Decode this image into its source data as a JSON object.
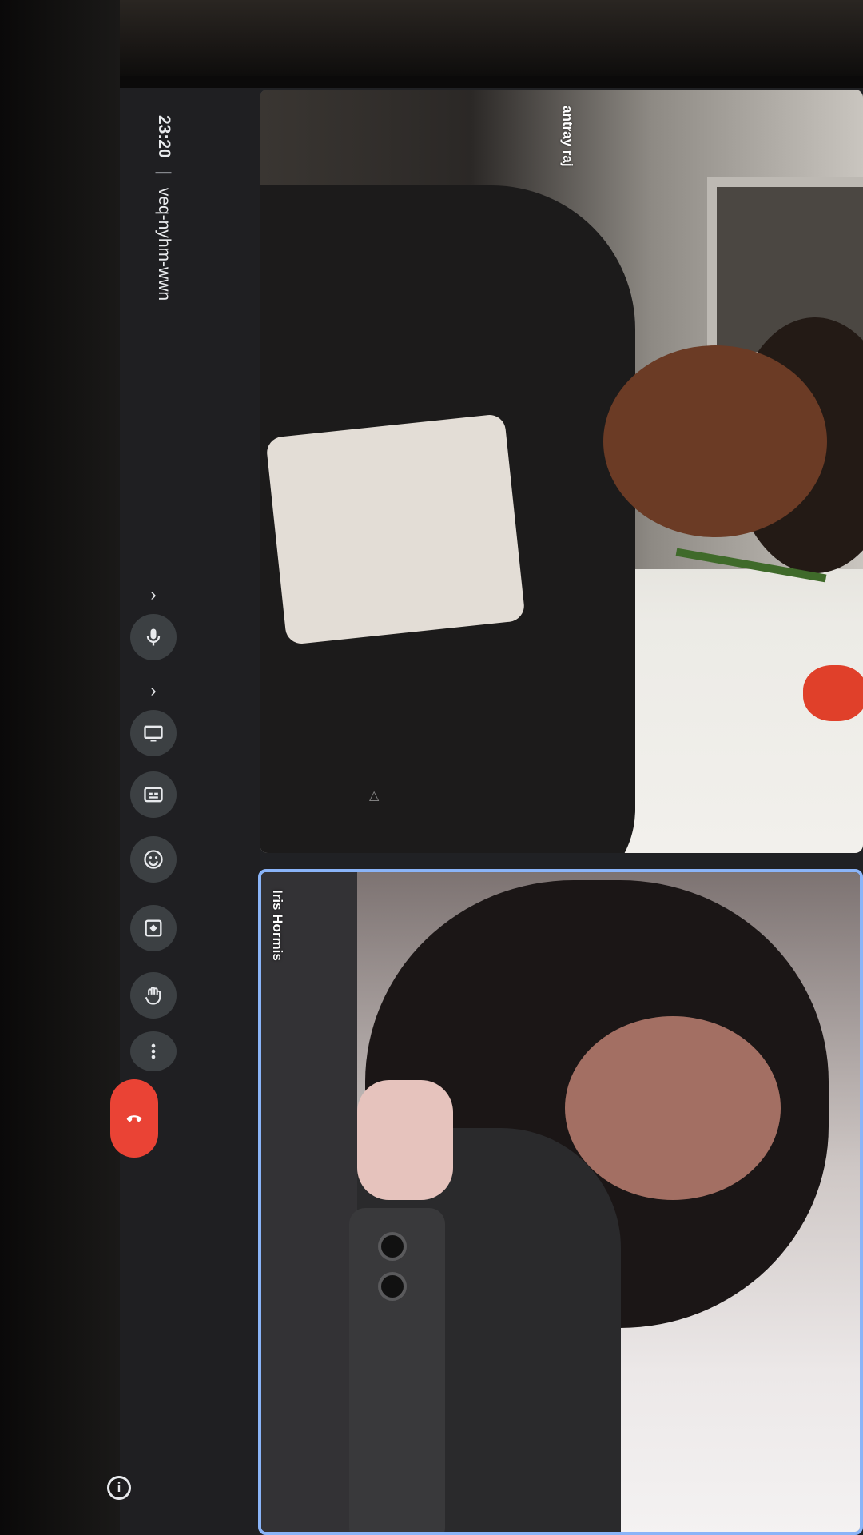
{
  "meeting": {
    "time": "23:20",
    "separator": "|",
    "code": "veq-nyhm-wwn"
  },
  "participants": [
    {
      "name": "antray raj"
    },
    {
      "name": "Iris Hormis"
    }
  ],
  "controls": {
    "mic_icon": "microphone-icon",
    "present_icon": "present-screen-icon",
    "captions_icon": "captions-icon",
    "emoji_icon": "emoji-icon",
    "share_icon": "share-icon",
    "raise_hand_icon": "raise-hand-icon",
    "more_icon": "more-options-icon",
    "hangup_icon": "hang-up-icon",
    "info_label": "i"
  },
  "colors": {
    "hangup": "#ea4335",
    "active_speaker_border": "#8ab4f8",
    "control_bg": "#3c4043"
  }
}
